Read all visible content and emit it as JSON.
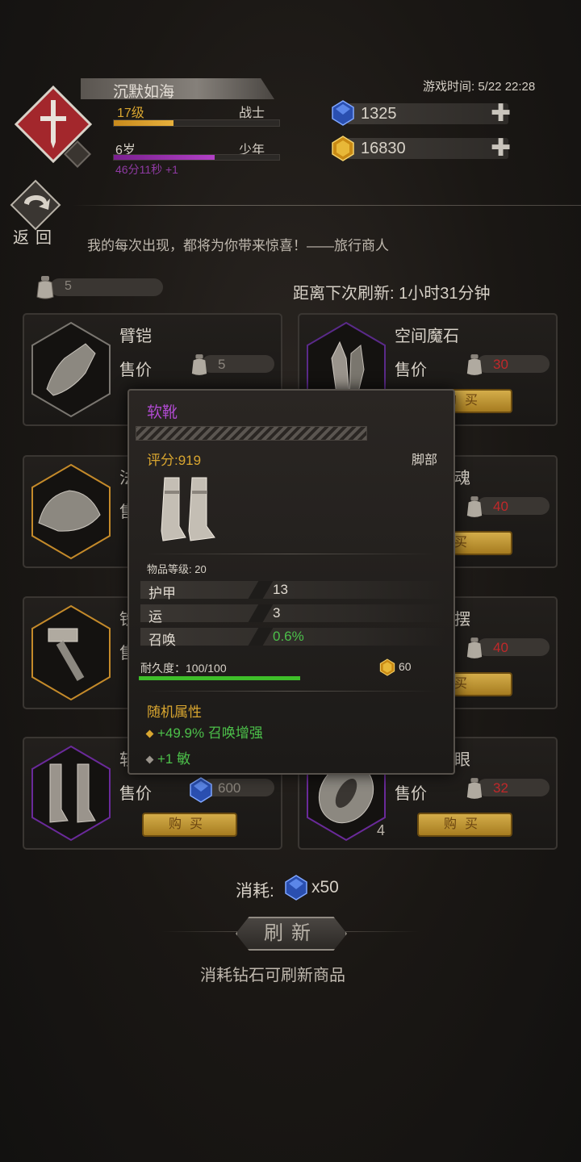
{
  "player": {
    "name": "沉默如海",
    "level": "17级",
    "class": "战士",
    "age": "6岁",
    "stage": "少年",
    "timer": "46分11秒 +1",
    "xp_progress": 0.36,
    "age_progress": 0.61
  },
  "game_time": "游戏时间: 5/22 22:28",
  "currency": {
    "diamonds": "1325",
    "gold": "16830"
  },
  "nav": {
    "back_label": "返回"
  },
  "merchant_quote": "我的每次出现，都将为你带来惊喜！——旅行商人",
  "bag_count": "5",
  "refresh_timer": "距离下次刷新: 1小时31分钟",
  "shop_items": [
    {
      "name": "臂铠",
      "price_label": "售价",
      "price": "5",
      "buy": "购买",
      "rarity_color": "#7a7670"
    },
    {
      "name": "空间魔石",
      "price_label": "售价",
      "price": "30",
      "buy": "购买",
      "rarity_color": "#5a2a8a"
    },
    {
      "name": "法",
      "price_label": "售",
      "price": "",
      "buy": "购买",
      "rarity_color": "#c48a2a"
    },
    {
      "name": "魂",
      "price_label": "",
      "price": "40",
      "buy": "买",
      "rarity_color": "#5a2a8a"
    },
    {
      "name": "铁",
      "price_label": "售",
      "price": "",
      "buy": "购买",
      "rarity_color": "#c48a2a"
    },
    {
      "name": "摆",
      "price_label": "",
      "price": "40",
      "buy": "买",
      "rarity_color": "#c48a2a"
    },
    {
      "name": "软",
      "price_label": "售价",
      "price": "600",
      "buy": "购买",
      "rarity_color": "#6a2a9a"
    },
    {
      "name": "眼",
      "price_label": "售价",
      "price": "32",
      "buy": "购买",
      "rarity_color": "#6a2a9a",
      "stack": "4"
    }
  ],
  "refresh": {
    "cost_label": "消耗:",
    "cost_value": "x50",
    "button_label": "刷新",
    "hint": "消耗钻石可刷新商品"
  },
  "tooltip": {
    "title": "软靴",
    "score": "评分:919",
    "slot": "脚部",
    "item_level": "物品等级: 20",
    "stats": [
      {
        "name": "护甲",
        "value": "13",
        "color": "#e0dad0"
      },
      {
        "name": "运",
        "value": "3",
        "color": "#e0dad0"
      },
      {
        "name": "召唤",
        "value": "0.6%",
        "color": "#4cc04a"
      }
    ],
    "durability": "耐久度：100/100",
    "durability_ratio": 1.0,
    "sell_value": "60",
    "random_header": "随机属性",
    "random_attrs": [
      "+49.9% 召唤增强",
      "+1 敏"
    ]
  },
  "colors": {
    "accent_gold": "#d9a630",
    "price_red": "#c0282a",
    "rare_purple": "#b04ad0",
    "bonus_green": "#4cc04a"
  }
}
